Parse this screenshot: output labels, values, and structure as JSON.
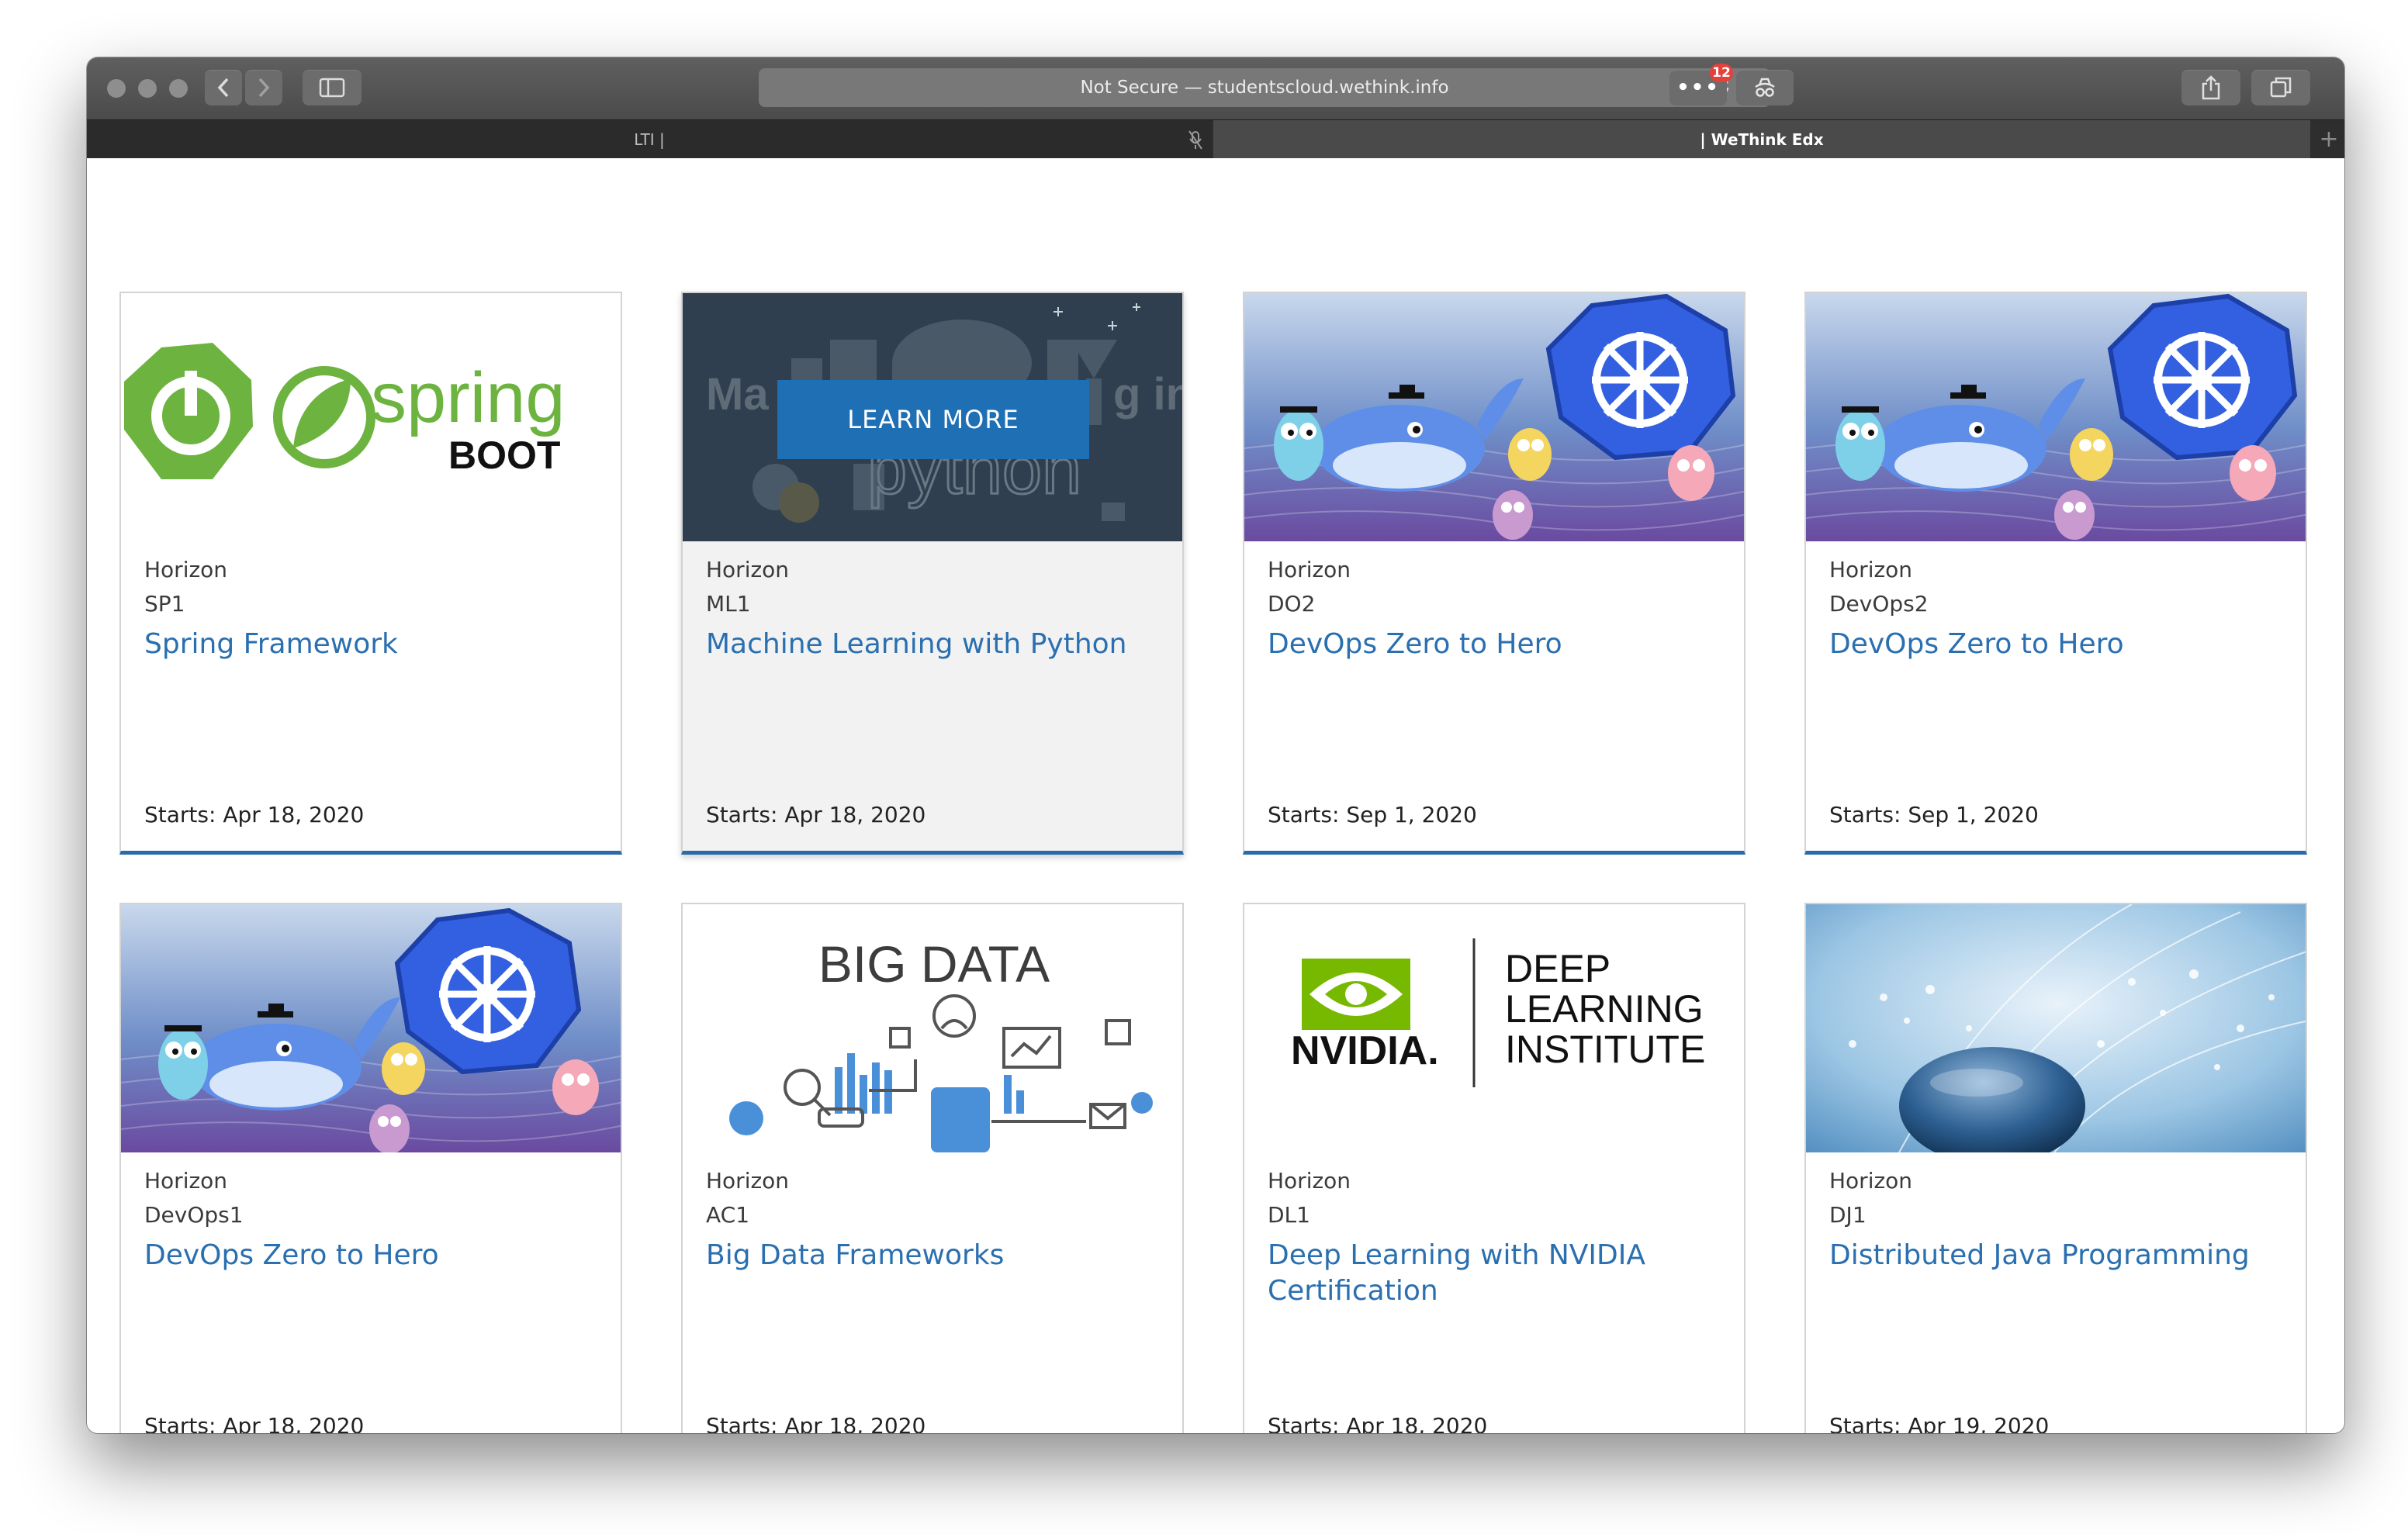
{
  "browser": {
    "address": "Not Secure — studentscloud.wethink.info",
    "extension_badge": "12",
    "tabs": [
      {
        "label": "LTI |"
      },
      {
        "label": "| WeThink Edx"
      }
    ]
  },
  "courses": [
    {
      "org": "Horizon",
      "code": "SP1",
      "title": "Spring Framework",
      "date": "Starts: Apr 18, 2020",
      "image": "spring-boot-logo",
      "logo_text": "spring",
      "logo_sub": "BOOT"
    },
    {
      "org": "Horizon",
      "code": "ML1",
      "title": "Machine Learning with Python",
      "date": "Starts: Apr 18, 2020",
      "image": "machine-learning-python",
      "hover_button": "LEARN MORE"
    },
    {
      "org": "Horizon",
      "code": "DO2",
      "title": "DevOps Zero to Hero",
      "date": "Starts: Sep 1, 2020",
      "image": "kubernetes-docker-go-mascots"
    },
    {
      "org": "Horizon",
      "code": "DevOps2",
      "title": "DevOps Zero to Hero",
      "date": "Starts: Sep 1, 2020",
      "image": "kubernetes-docker-go-mascots"
    },
    {
      "org": "Horizon",
      "code": "DevOps1",
      "title": "DevOps Zero to Hero",
      "date": "Starts: Apr 18, 2020",
      "image": "kubernetes-docker-go-mascots"
    },
    {
      "org": "Horizon",
      "code": "AC1",
      "title": "Big Data Frameworks",
      "date": "Starts: Apr 18, 2020",
      "image": "big-data-illustration",
      "logo_text": "BIG DATA"
    },
    {
      "org": "Horizon",
      "code": "DL1",
      "title": "Deep Learning with NVIDIA Certification",
      "date": "Starts: Apr 18, 2020",
      "image": "nvidia-dli-logo",
      "logo_text": "NVIDIA.",
      "logo_lines": [
        "DEEP",
        "LEARNING",
        "INSTITUTE"
      ]
    },
    {
      "org": "Horizon",
      "code": "DJ1",
      "title": "Distributed Java Programming",
      "date": "Starts: Apr 19, 2020",
      "image": "water-sphere-photo"
    }
  ],
  "colors": {
    "link": "#2a6fb0",
    "card_accent": "#2a6aa8",
    "button": "#1f6fb4",
    "spring_green": "#6db33f",
    "nvidia_green": "#76b900"
  }
}
